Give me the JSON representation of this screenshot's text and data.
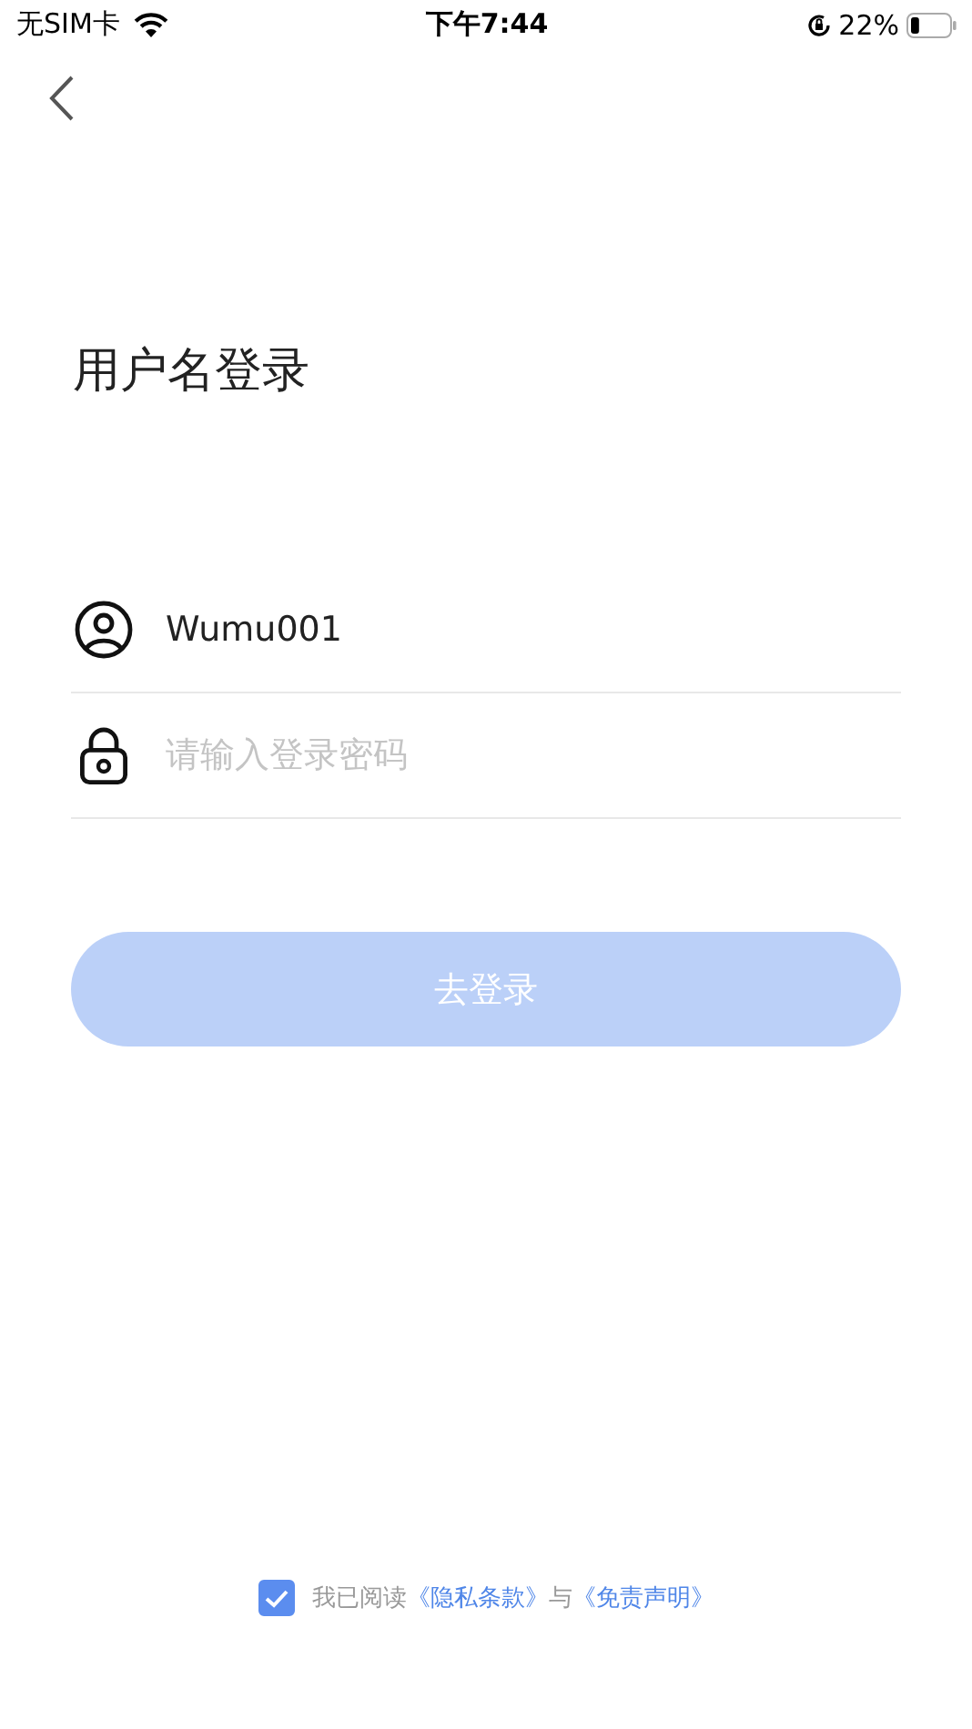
{
  "status_bar": {
    "carrier": "无SIM卡",
    "time": "下午7:44",
    "battery": "22%"
  },
  "title": "用户名登录",
  "fields": [
    {
      "kind": "user",
      "value": "Wumu001"
    },
    {
      "kind": "password",
      "placeholder": "请输入登录密码"
    }
  ],
  "login_button": {
    "label": "去登录",
    "disabled": true
  },
  "agreement": {
    "checked": true,
    "parts": [
      {
        "kind": "text",
        "text": "我已阅读"
      },
      {
        "kind": "link",
        "text": "《隐私条款》"
      },
      {
        "kind": "text",
        "text": "与"
      },
      {
        "kind": "link",
        "text": "《免责声明》"
      }
    ]
  }
}
